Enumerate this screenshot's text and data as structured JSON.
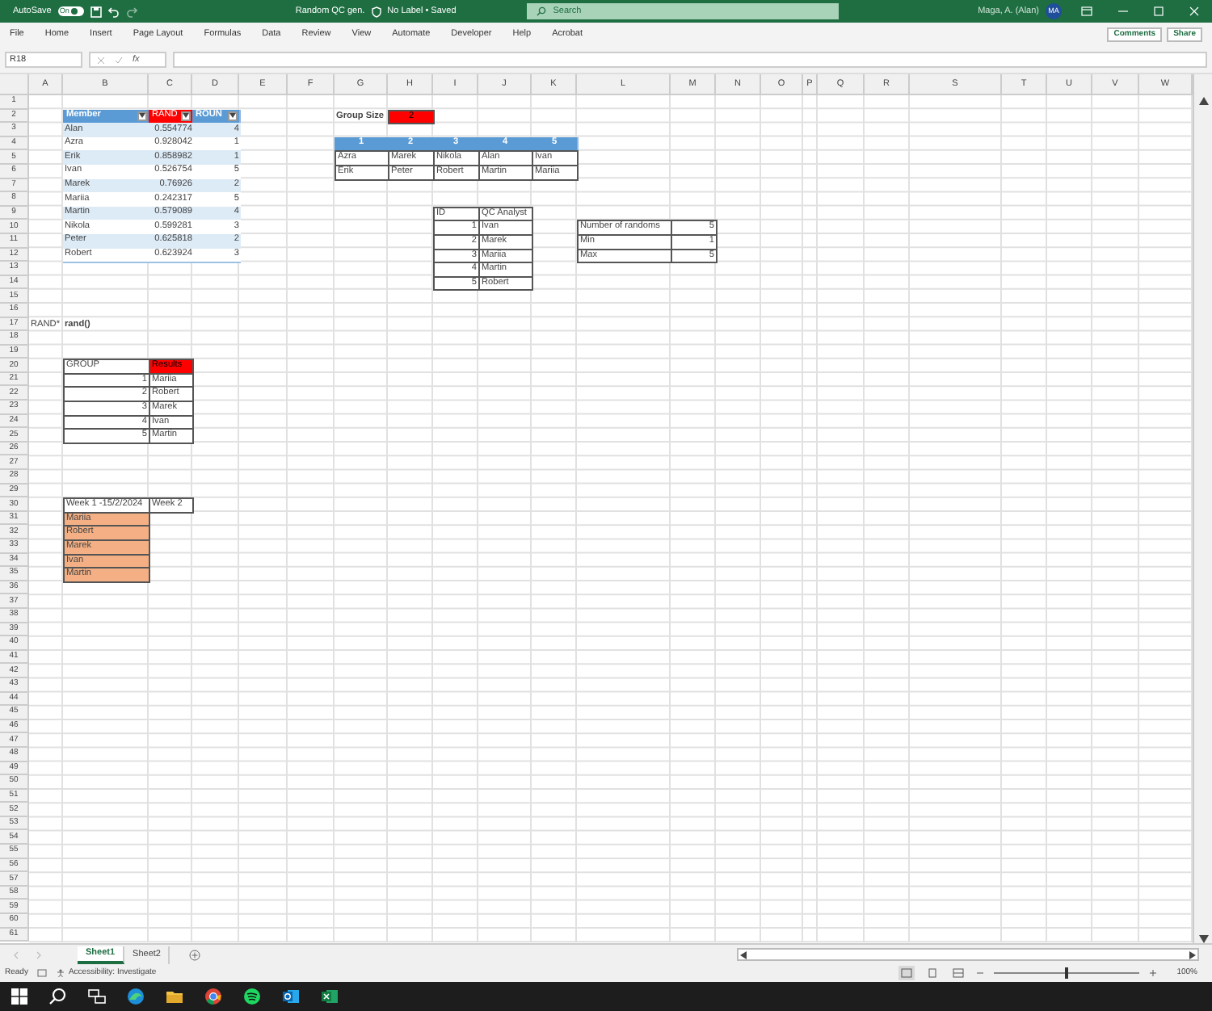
{
  "title_bar": {
    "autosave": "AutoSave",
    "toggle": {
      "label": "On",
      "on": true
    },
    "document": "Random QC gen.",
    "label_status": "No Label • Saved",
    "search": {
      "placeholder": "Search"
    },
    "user": "Maga, A. (Alan)",
    "avatar": "MA"
  },
  "ribbon_tabs": [
    "File",
    "Home",
    "Insert",
    "Page Layout",
    "Formulas",
    "Data",
    "Review",
    "View",
    "Automate",
    "Developer",
    "Help",
    "Acrobat"
  ],
  "ribbon_buttons": [
    "Comments",
    "Share"
  ],
  "formula_bar": {
    "name_box": "R18",
    "fx": "fx"
  },
  "columns": [
    "A",
    "B",
    "C",
    "D",
    "E",
    "F",
    "G",
    "H",
    "I",
    "J",
    "K",
    "L",
    "M",
    "N",
    "O",
    "P",
    "Q",
    "R",
    "S",
    "T",
    "U",
    "V",
    "W"
  ],
  "rows": [
    "1",
    "2",
    "3",
    "4",
    "5",
    "6",
    "7",
    "8",
    "9",
    "10",
    "11",
    "12",
    "13",
    "14",
    "15",
    "16",
    "17",
    "18",
    "19",
    "20",
    "21",
    "22",
    "23",
    "24",
    "25",
    "26",
    "27",
    "28",
    "29",
    "30",
    "31",
    "32",
    "33",
    "34",
    "35",
    "36",
    "37",
    "38",
    "39",
    "40",
    "41",
    "42",
    "43",
    "44",
    "45",
    "46",
    "47",
    "48",
    "49",
    "50",
    "51",
    "52",
    "53",
    "54",
    "55",
    "56",
    "57",
    "58",
    "59",
    "60",
    "61"
  ],
  "member_table": {
    "columns": [
      {
        "label": "Member",
        "highlight": false,
        "filter": true
      },
      {
        "label": "RAND",
        "highlight": true,
        "filter": true
      },
      {
        "label": "ROUN",
        "highlight": false,
        "filter": true
      }
    ],
    "rows": [
      {
        "member": "Alan",
        "rand": "0.554774",
        "round": "4"
      },
      {
        "member": "Azra",
        "rand": "0.928042",
        "round": "1"
      },
      {
        "member": "Erik",
        "rand": "0.858982",
        "round": "1"
      },
      {
        "member": "Ivan",
        "rand": "0.526754",
        "round": "5"
      },
      {
        "member": "Marek",
        "rand": "0.76926",
        "round": "2"
      },
      {
        "member": "Mariia",
        "rand": "0.242317",
        "round": "5"
      },
      {
        "member": "Martin",
        "rand": "0.579089",
        "round": "4"
      },
      {
        "member": "Nikola",
        "rand": "0.599281",
        "round": "3"
      },
      {
        "member": "Peter",
        "rand": "0.625818",
        "round": "2"
      },
      {
        "member": "Robert",
        "rand": "0.623924",
        "round": "3"
      }
    ]
  },
  "group_size": {
    "label": "Group Size",
    "value": "2",
    "highlight": true
  },
  "groups_table": {
    "headers": [
      "1",
      "2",
      "3",
      "4",
      "5"
    ],
    "rows": [
      [
        "Azra",
        "Marek",
        "Nikola",
        "Alan",
        "Ivan"
      ],
      [
        "Erik",
        "Peter",
        "Robert",
        "Martin",
        "Mariia"
      ]
    ]
  },
  "qc_table": {
    "headers": [
      "ID",
      "QC Analyst"
    ],
    "rows": [
      {
        "id": "1",
        "name": "Ivan"
      },
      {
        "id": "2",
        "name": "Marek"
      },
      {
        "id": "3",
        "name": "Mariia"
      },
      {
        "id": "4",
        "name": "Martin"
      },
      {
        "id": "5",
        "name": "Robert"
      }
    ]
  },
  "stats_table": [
    {
      "label": "Number of randoms",
      "value": "5"
    },
    {
      "label": "Min",
      "value": "1"
    },
    {
      "label": "Max",
      "value": "5"
    }
  ],
  "formula_note": {
    "label": "RAND*",
    "formula": "rand()"
  },
  "results_table": {
    "headers": [
      {
        "label": "GROUP",
        "highlight": false
      },
      {
        "label": "Results",
        "highlight": true
      }
    ],
    "rows": [
      {
        "group": "1",
        "name": "Mariia"
      },
      {
        "group": "2",
        "name": "Robert"
      },
      {
        "group": "3",
        "name": "Marek"
      },
      {
        "group": "4",
        "name": "Ivan"
      },
      {
        "group": "5",
        "name": "Martin"
      }
    ]
  },
  "week_table": {
    "headers": [
      "Week 1 -15/2/2024",
      "Week 2"
    ],
    "rows": [
      "Mariia",
      "Robert",
      "Marek",
      "Ivan",
      "Martin"
    ]
  },
  "sheet_tabs": [
    {
      "label": "Sheet1",
      "selected": true
    },
    {
      "label": "Sheet2",
      "selected": false
    }
  ],
  "status_bar": {
    "status": "Ready",
    "accessibility": "Accessibility: Investigate",
    "zoom": {
      "level": 0.5
    },
    "zoom_text": "100%"
  }
}
